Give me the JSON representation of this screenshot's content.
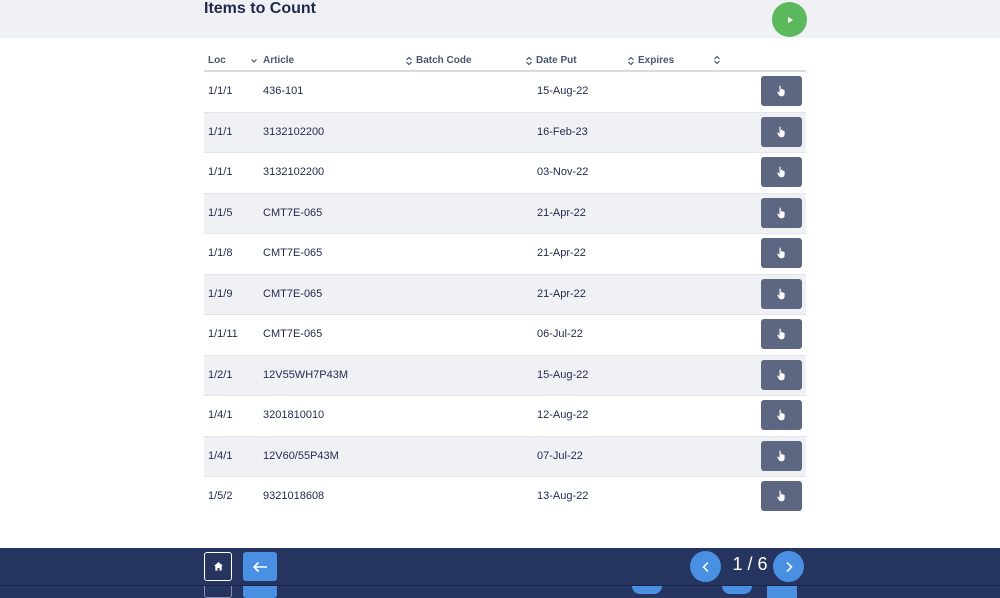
{
  "header": {
    "title": "Items to Count"
  },
  "columns": [
    {
      "label": "Loc"
    },
    {
      "label": "Article"
    },
    {
      "label": "Batch Code"
    },
    {
      "label": "Date Put"
    },
    {
      "label": "Expires"
    }
  ],
  "rows": [
    {
      "loc": "1/1/1",
      "article": "436-101",
      "batch": "",
      "date_put": "15-Aug-22",
      "expires": ""
    },
    {
      "loc": "1/1/1",
      "article": "3132102200",
      "batch": "",
      "date_put": "16-Feb-23",
      "expires": ""
    },
    {
      "loc": "1/1/1",
      "article": "3132102200",
      "batch": "",
      "date_put": "03-Nov-22",
      "expires": ""
    },
    {
      "loc": "1/1/5",
      "article": "CMT7E-065",
      "batch": "",
      "date_put": "21-Apr-22",
      "expires": ""
    },
    {
      "loc": "1/1/8",
      "article": "CMT7E-065",
      "batch": "",
      "date_put": "21-Apr-22",
      "expires": ""
    },
    {
      "loc": "1/1/9",
      "article": "CMT7E-065",
      "batch": "",
      "date_put": "21-Apr-22",
      "expires": ""
    },
    {
      "loc": "1/1/11",
      "article": "CMT7E-065",
      "batch": "",
      "date_put": "06-Jul-22",
      "expires": ""
    },
    {
      "loc": "1/2/1",
      "article": "12V55WH7P43M",
      "batch": "",
      "date_put": "15-Aug-22",
      "expires": ""
    },
    {
      "loc": "1/4/1",
      "article": "3201810010",
      "batch": "",
      "date_put": "12-Aug-22",
      "expires": ""
    },
    {
      "loc": "1/4/1",
      "article": "12V60/55P43M",
      "batch": "",
      "date_put": "07-Jul-22",
      "expires": ""
    },
    {
      "loc": "1/5/2",
      "article": "9321018608",
      "batch": "",
      "date_put": "13-Aug-22",
      "expires": ""
    }
  ],
  "pagination": {
    "current": 1,
    "total": 6,
    "text": "1 / 6"
  },
  "icons": {
    "run": "play-icon",
    "row_action": "hand-pointer-icon",
    "home": "home-icon",
    "back": "arrow-left-icon",
    "prev": "chevron-left-icon",
    "next": "chevron-right-icon",
    "sort": "sort-icon",
    "sort_active": "sort-down-icon"
  },
  "colors": {
    "accent": "#4a90e2",
    "run": "#5cb85c",
    "footer": "#253560",
    "row_button": "#5d6782",
    "title": "#1e2a4a"
  }
}
